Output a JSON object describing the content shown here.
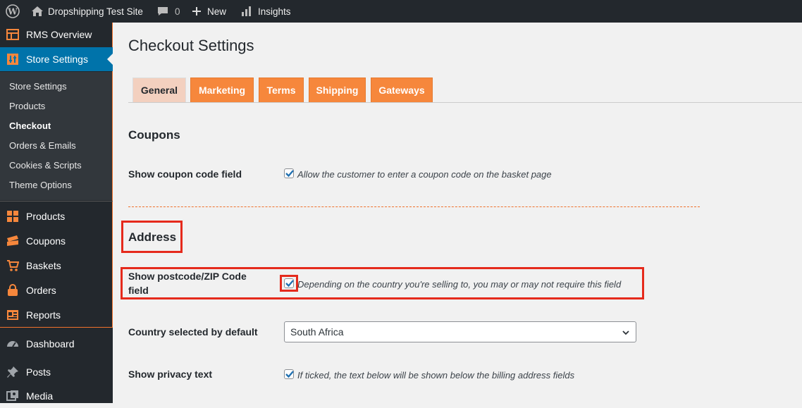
{
  "adminbar": {
    "site_name": "Dropshipping Test Site",
    "comments_count": "0",
    "new_label": "New",
    "insights_label": "Insights"
  },
  "sidebar": {
    "rms_overview": "RMS Overview",
    "store_settings": "Store Settings",
    "submenu": [
      "Store Settings",
      "Products",
      "Checkout",
      "Orders & Emails",
      "Cookies & Scripts",
      "Theme Options"
    ],
    "current_submenu": "Checkout",
    "items": [
      "Products",
      "Coupons",
      "Baskets",
      "Orders",
      "Reports"
    ],
    "dashboard": "Dashboard",
    "posts": "Posts",
    "media": "Media"
  },
  "page": {
    "title": "Checkout Settings",
    "tabs": [
      "General",
      "Marketing",
      "Terms",
      "Shipping",
      "Gateways"
    ],
    "active_tab": "General"
  },
  "coupons": {
    "heading": "Coupons",
    "label": "Show coupon code field",
    "desc": "Allow the customer to enter a coupon code on the basket page",
    "checked": true
  },
  "address": {
    "heading": "Address",
    "postcode_label_line1": "Show postcode/ZIP Code",
    "postcode_label_line2": "field",
    "postcode_desc": "Depending on the country you're selling to, you may or may not require this field",
    "postcode_checked": true,
    "country_label": "Country selected by default",
    "country_value": "South Africa",
    "privacy_label": "Show privacy text",
    "privacy_desc": "If ticked, the text below will be shown below the billing address fields",
    "privacy_checked": true
  },
  "colors": {
    "accent_orange": "#f6873c",
    "active_blue": "#0073aa",
    "annotation_red": "#e52a1c"
  }
}
